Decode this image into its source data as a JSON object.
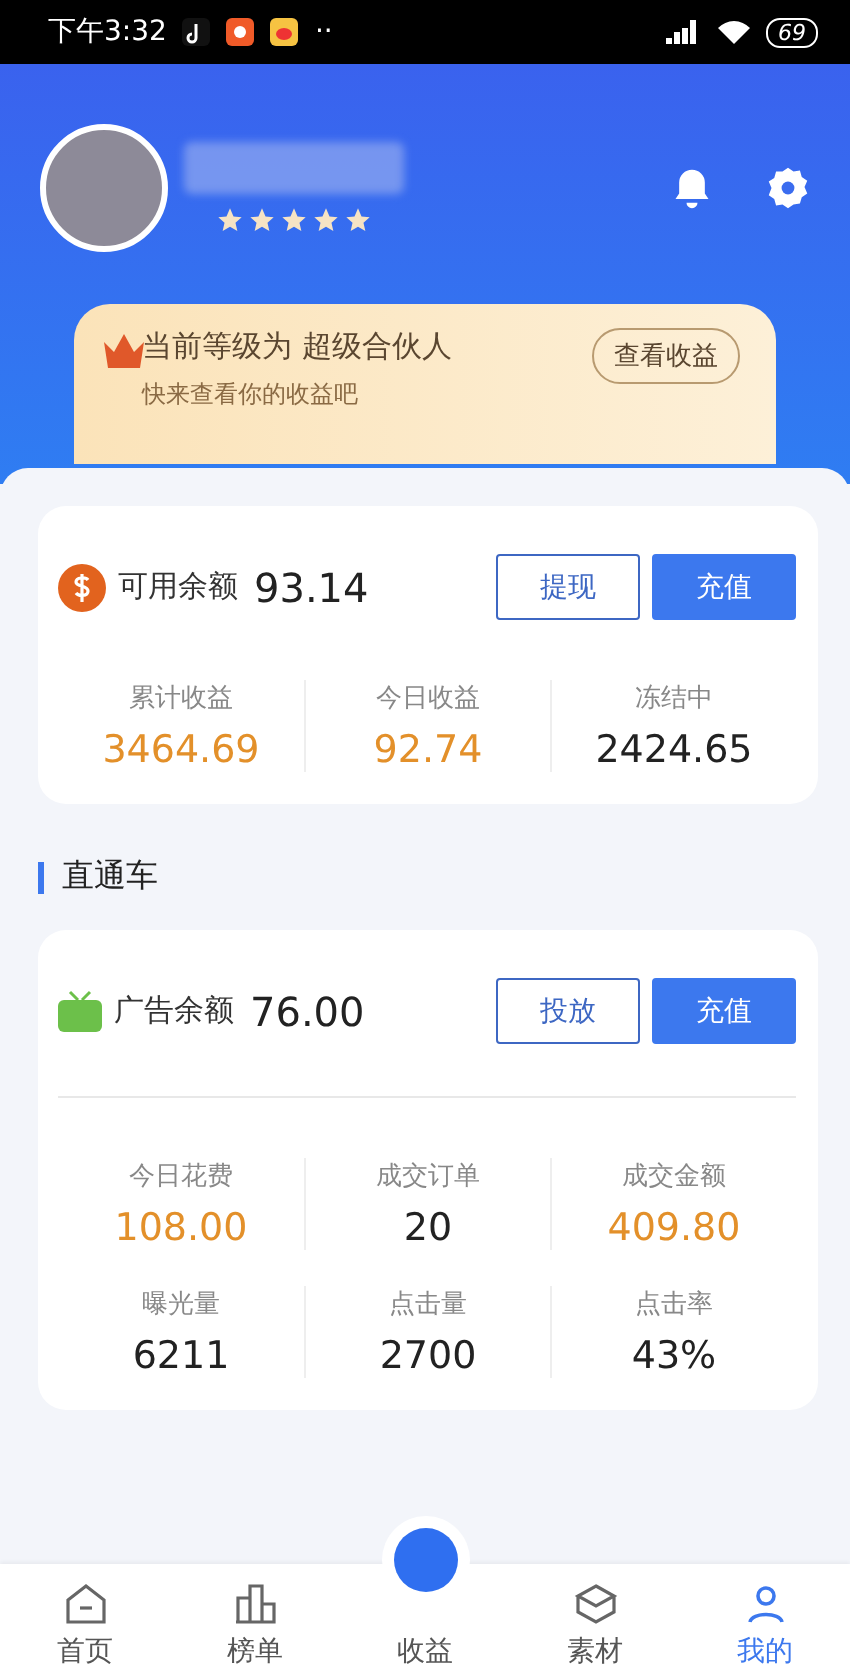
{
  "status_bar": {
    "time": "下午3:32",
    "more": "··",
    "battery": "69"
  },
  "profile": {
    "stars": 5
  },
  "level_card": {
    "title": "当前等级为 超级合伙人",
    "subtitle": "快来查看你的收益吧",
    "button": "查看收益"
  },
  "balance_card": {
    "label": "可用余额",
    "amount": "93.14",
    "buttons": [
      {
        "label": "提现",
        "kind": "outline"
      },
      {
        "label": "充值",
        "kind": "solid"
      }
    ],
    "stats": [
      {
        "label": "累计收益",
        "value": "3464.69",
        "highlight": true
      },
      {
        "label": "今日收益",
        "value": "92.74",
        "highlight": true
      },
      {
        "label": "冻结中",
        "value": "2424.65",
        "highlight": false
      }
    ]
  },
  "section_title": "直通车",
  "ad_card": {
    "label": "广告余额",
    "amount": "76.00",
    "buttons": [
      {
        "label": "投放",
        "kind": "outline"
      },
      {
        "label": "充值",
        "kind": "solid"
      }
    ],
    "stats": [
      {
        "label": "今日花费",
        "value": "108.00",
        "highlight": true
      },
      {
        "label": "成交订单",
        "value": "20",
        "highlight": false
      },
      {
        "label": "成交金额",
        "value": "409.80",
        "highlight": true
      },
      {
        "label": "曝光量",
        "value": "6211",
        "highlight": false
      },
      {
        "label": "点击量",
        "value": "2700",
        "highlight": false
      },
      {
        "label": "点击率",
        "value": "43%",
        "highlight": false
      }
    ]
  },
  "tab_bar": [
    {
      "label": "首页",
      "selected": false
    },
    {
      "label": "榜单",
      "selected": false
    },
    {
      "label": "收益",
      "selected": false
    },
    {
      "label": "素材",
      "selected": false
    },
    {
      "label": "我的",
      "selected": true
    }
  ]
}
